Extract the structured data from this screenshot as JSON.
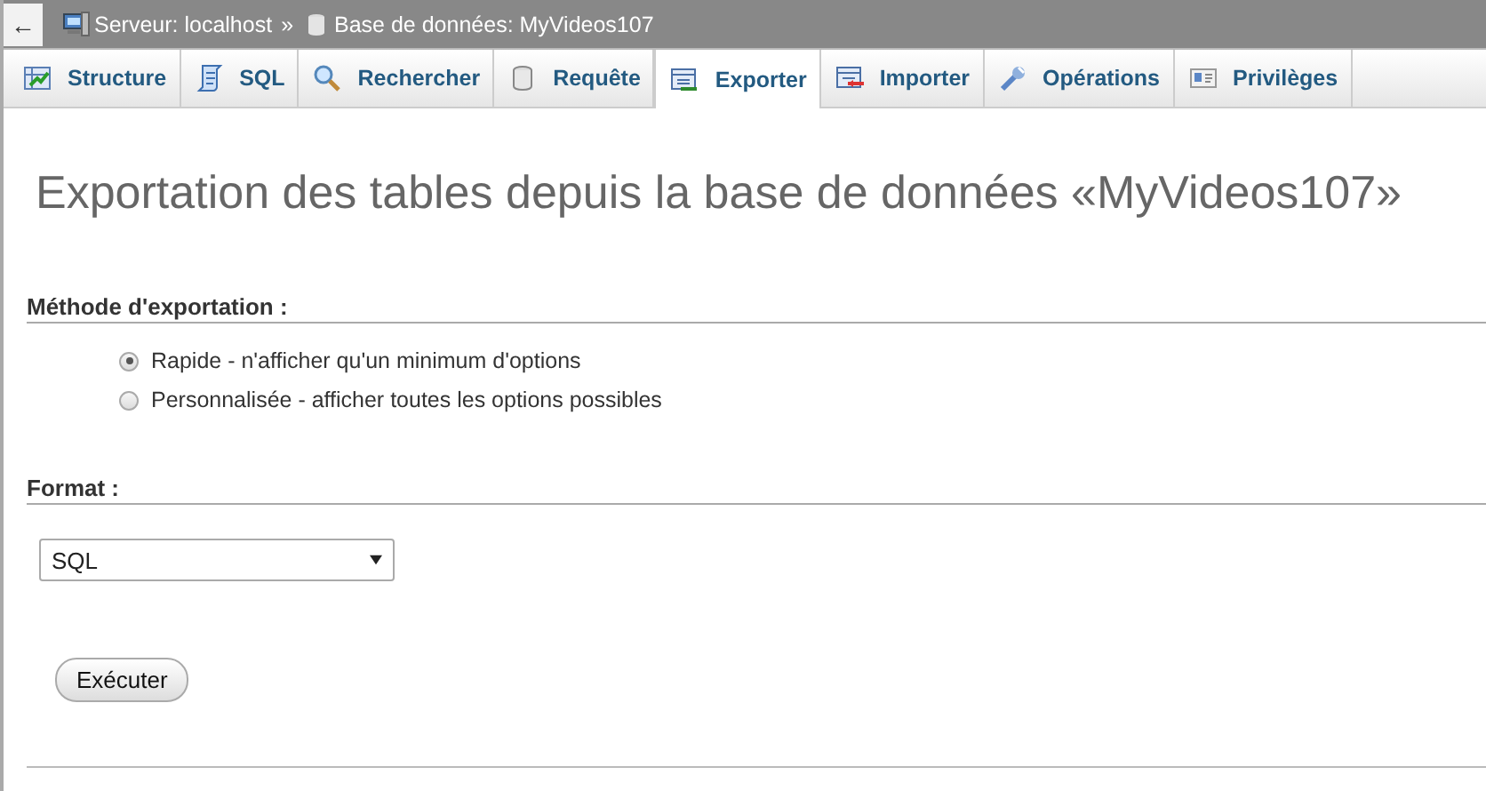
{
  "breadcrumb": {
    "back": "←",
    "items": [
      {
        "kind": "server",
        "label": "Serveur: localhost"
      },
      {
        "kind": "separator",
        "label": "»"
      },
      {
        "kind": "database",
        "label": "Base de données: MyVideos107"
      }
    ]
  },
  "tabs": [
    {
      "label": "Structure",
      "selected": false
    },
    {
      "label": "SQL",
      "selected": false
    },
    {
      "label": "Rechercher",
      "selected": false
    },
    {
      "label": "Requête",
      "selected": false
    },
    {
      "label": "Exporter",
      "selected": true
    },
    {
      "label": "Importer",
      "selected": false
    },
    {
      "label": "Opérations",
      "selected": false
    },
    {
      "label": "Privilèges",
      "selected": false
    }
  ],
  "heading": "Exportation des tables depuis la base de données «MyVideos107»",
  "method": {
    "legend": "Méthode d'exportation :",
    "options": [
      {
        "label": "Rapide - n'afficher qu'un minimum d'options",
        "selected": true
      },
      {
        "label": "Personnalisée - afficher toutes les options possibles",
        "selected": false
      }
    ]
  },
  "format": {
    "legend": "Format :",
    "value": "SQL"
  },
  "button": "Exécuter"
}
